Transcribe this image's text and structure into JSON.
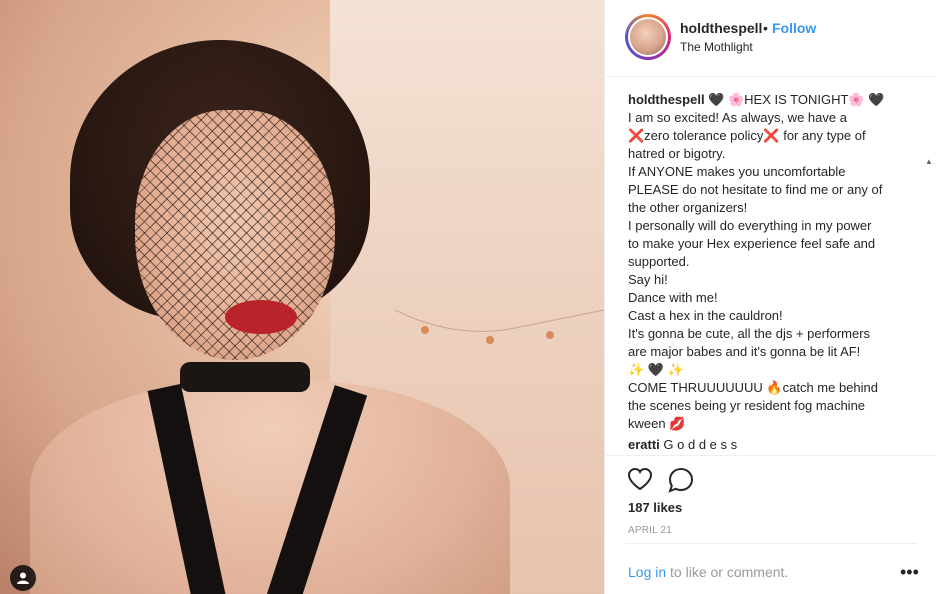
{
  "post": {
    "username": "holdthespell",
    "separator": "•",
    "follow_label": "Follow",
    "location": "The Mothlight"
  },
  "caption": {
    "username": "holdthespell",
    "lines": [
      "🖤 🌸HEX IS TONIGHT🌸 🖤",
      "I am so excited! As always, we have a",
      "❌zero tolerance policy❌ for any type of",
      "hatred or bigotry.",
      "If ANYONE makes you uncomfortable",
      "PLEASE do not hesitate to find me or any of",
      "the other organizers!",
      "I personally will do everything in my power",
      "to make your Hex experience feel safe and",
      "supported.",
      "Say hi!",
      "Dance with me!",
      "Cast a hex in the cauldron!",
      "It's gonna be cute, all the djs + performers",
      "are major babes and it's gonna be lit AF!",
      "✨ 🖤 ✨",
      "COME THRUUUUUUU 🔥catch me behind",
      "the scenes being yr resident fog machine",
      "kween 💋"
    ]
  },
  "comment": {
    "username": "eratti",
    "text": "G o d d e s s"
  },
  "stats": {
    "likes": "187 likes",
    "date": "APRIL 21"
  },
  "login": {
    "link": "Log in",
    "text": " to like or comment."
  },
  "more_label": "•••",
  "icons": [
    "heart-icon",
    "comment-icon",
    "user-tag-icon",
    "scroll-up-icon",
    "scroll-down-icon"
  ]
}
